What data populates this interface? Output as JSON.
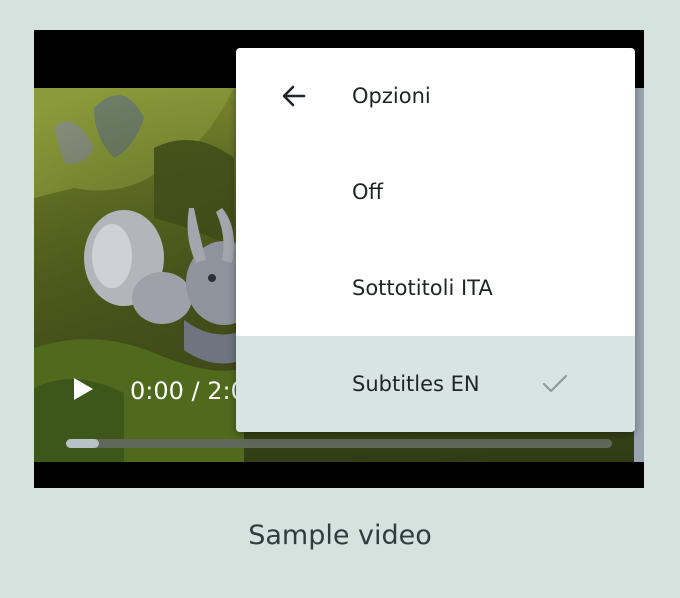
{
  "menu": {
    "title": "Opzioni",
    "items": [
      {
        "label": "Off",
        "selected": false
      },
      {
        "label": "Sottotitoli ITA",
        "selected": false
      },
      {
        "label": "Subtitles EN",
        "selected": true
      }
    ]
  },
  "controls": {
    "time": "0:00 / 2:0",
    "progress_buffered": 0.06
  },
  "icons": {
    "back": "arrow-left-icon",
    "check": "check-icon",
    "play": "play-icon"
  },
  "caption": "Sample video",
  "colors": {
    "page_background": "#d5e3de",
    "selected_row": "#d8e4e1",
    "check": "#8d9aa0",
    "buffer": "#b8c1c6",
    "track": "#5f6858"
  }
}
